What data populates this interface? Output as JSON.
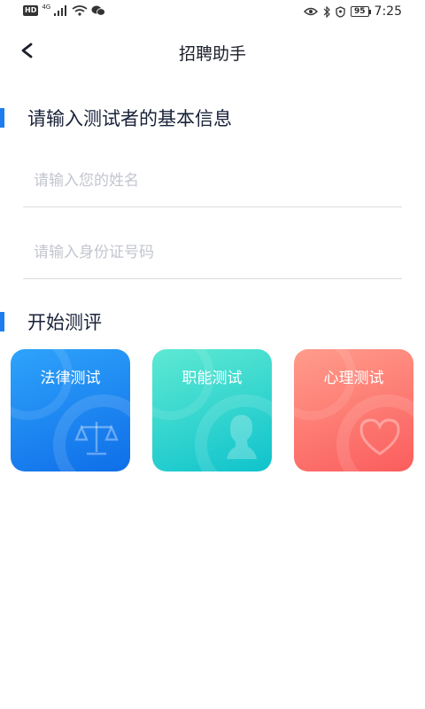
{
  "status_bar": {
    "hd": "HD",
    "network": "4G",
    "battery": "95",
    "time": "7:25"
  },
  "header": {
    "title": "招聘助手",
    "back_icon": "chevron-left-icon"
  },
  "info_section": {
    "title": "请输入测试者的基本信息",
    "name_placeholder": "请输入您的姓名",
    "id_placeholder": "请输入身份证号码"
  },
  "eval_section": {
    "title": "开始测评",
    "cards": [
      {
        "label": "法律测试",
        "icon": "scale-icon"
      },
      {
        "label": "职能测试",
        "icon": "person-silhouette-icon"
      },
      {
        "label": "心理测试",
        "icon": "heart-icon"
      }
    ]
  },
  "colors": {
    "accent": "#1d7cf2",
    "law_card": "#1f88f0",
    "job_card": "#2bd4cf",
    "psy_card": "#fd766f"
  }
}
